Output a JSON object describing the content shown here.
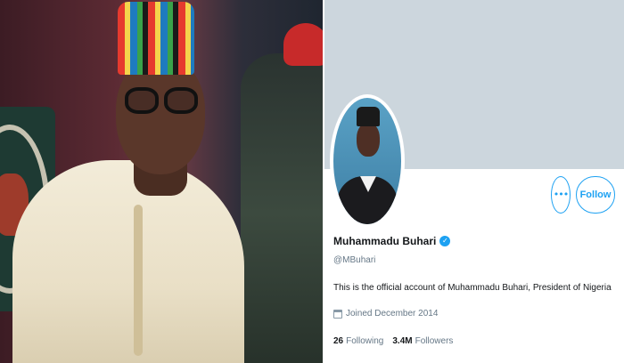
{
  "profile": {
    "display_name": "Muhammadu Buhari",
    "handle": "@MBuhari",
    "bio": "This is the official account of Muhammadu Buhari, President of Nigeria",
    "joined": "Joined December 2014",
    "following_count": "26",
    "following_label": "Following",
    "followers_count": "3.4M",
    "followers_label": "Followers",
    "verified_icon": "verified-badge-icon",
    "more_label": "•••",
    "follow_label": "Follow"
  },
  "colors": {
    "accent": "#1da1f2",
    "banner": "#ccd6dd",
    "text_primary": "#14171a",
    "text_secondary": "#657786"
  }
}
